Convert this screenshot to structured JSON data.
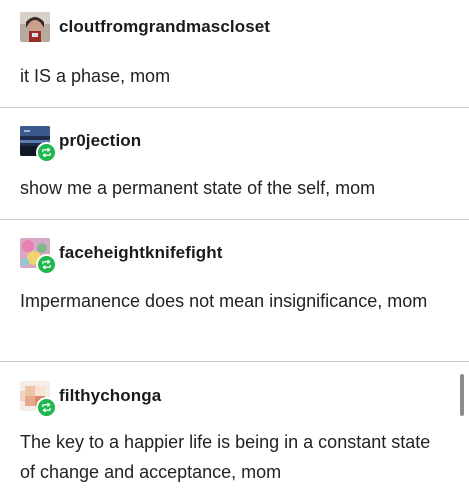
{
  "posts": [
    {
      "username": "cloutfromgrandmascloset",
      "text": "it IS a phase, mom",
      "reblogged": false,
      "avatar_icon": "portrait-avatar"
    },
    {
      "username": "pr0jection",
      "text": "show me a permanent state of the self, mom",
      "reblogged": true,
      "avatar_icon": "landscape-avatar"
    },
    {
      "username": "faceheightknifefight",
      "text": "Impermanence does not mean insignificance, mom",
      "reblogged": true,
      "avatar_icon": "pattern-avatar"
    },
    {
      "username": "filthychonga",
      "text": "The key to a happier life is being in a constant state of change and acceptance, mom",
      "reblogged": true,
      "avatar_icon": "pixelated-avatar"
    }
  ],
  "colors": {
    "reblog_badge": "#1fb84e",
    "divider": "#c9c9c9",
    "text": "#222222"
  }
}
